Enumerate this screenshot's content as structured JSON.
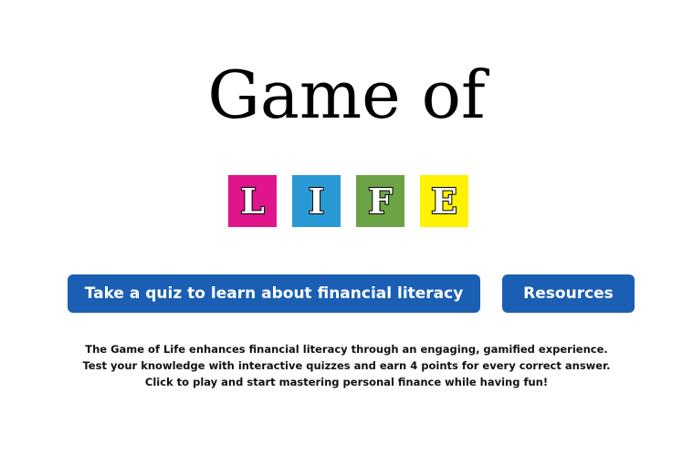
{
  "title": "Game of",
  "logo": {
    "letters": [
      {
        "char": "L",
        "color": "#e0148c"
      },
      {
        "char": "I",
        "color": "#2a9ad6"
      },
      {
        "char": "F",
        "color": "#6ba345"
      },
      {
        "char": "E",
        "color": "#fff200"
      }
    ]
  },
  "buttons": {
    "quiz_label": "Take a quiz to learn about financial literacy",
    "resources_label": "Resources",
    "color": "#1a5fb4"
  },
  "description": {
    "lines": [
      "The Game of Life enhances financial literacy through an engaging, gamified experience.",
      "Test your knowledge with interactive quizzes and earn 4 points for every correct answer.",
      "Click to play and start mastering personal finance while having fun!"
    ]
  }
}
